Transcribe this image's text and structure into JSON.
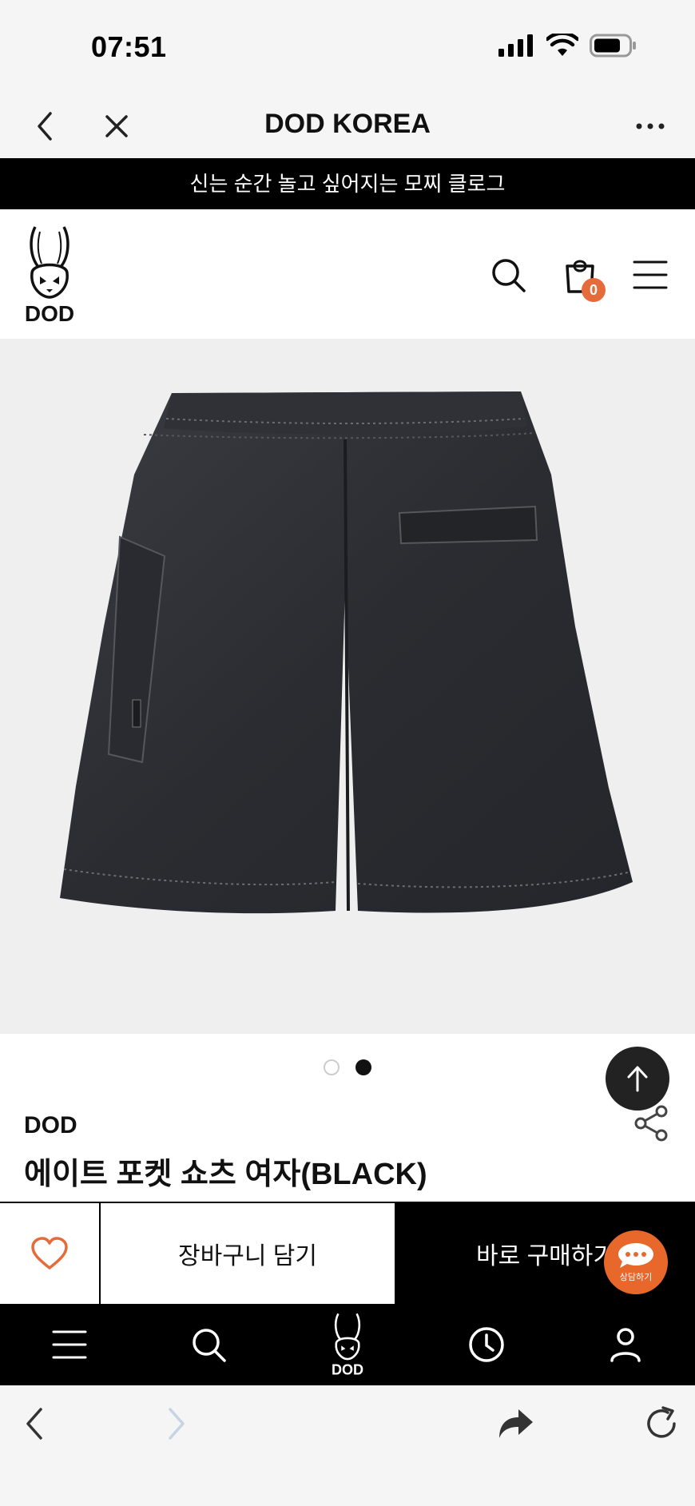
{
  "status": {
    "time": "07:51"
  },
  "browser": {
    "title": "DOD KOREA"
  },
  "promo": {
    "text": "신는 순간 놀고 싶어지는 모찌 클로그"
  },
  "logo": {
    "text": "DOD"
  },
  "cart": {
    "count": "0"
  },
  "product": {
    "brand": "DOD",
    "name": "에이트 포켓 쇼츠 여자(BLACK)",
    "image_count": 2,
    "active_image": 2
  },
  "actions": {
    "cart_label": "장바구니 담기",
    "buy_label": "바로 구매하기"
  },
  "chat": {
    "label": "상담하기"
  },
  "colors": {
    "accent": "#e56b3a",
    "black": "#000000"
  }
}
